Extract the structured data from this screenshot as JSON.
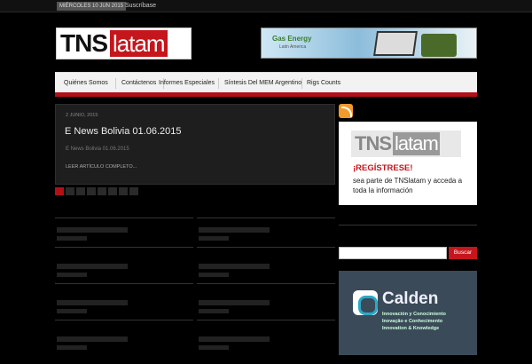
{
  "topbar": {
    "date": "MIÉRCOLES 10 JUN 2015",
    "subscribe": "Suscríbase"
  },
  "logo": {
    "part1": "TNS",
    "part2": "latam"
  },
  "banner": {
    "title": "Gas Energy",
    "subtitle": "Latin America"
  },
  "nav": {
    "items": [
      "Quiénes Somos",
      "Contáctenos",
      "Informes Especiales",
      "Síntesis Del MEM Argentino",
      "Rigs Counts"
    ]
  },
  "featured": {
    "date": "2 JUNIO, 2015",
    "title": "E News Bolivia 01.06.2015",
    "excerpt": "E News Bolivia 01.06.2015",
    "read_more": "LEER ARTÍCULO COMPLETO..."
  },
  "promo": {
    "logo1": "TNS",
    "logo2": "latam",
    "register": "¡REGÍSTRESE!",
    "text": "sea parte de TNSlatam y acceda a toda la información"
  },
  "search": {
    "button": "Buscar",
    "placeholder": ""
  },
  "calden": {
    "name": "Calden",
    "line1": "Innovación y Conocimiento",
    "line2": "Inovação e Conhecimento",
    "line3": "Innovation & Knowledge"
  },
  "colors": {
    "accent": "#c4161c",
    "background": "#000000"
  }
}
